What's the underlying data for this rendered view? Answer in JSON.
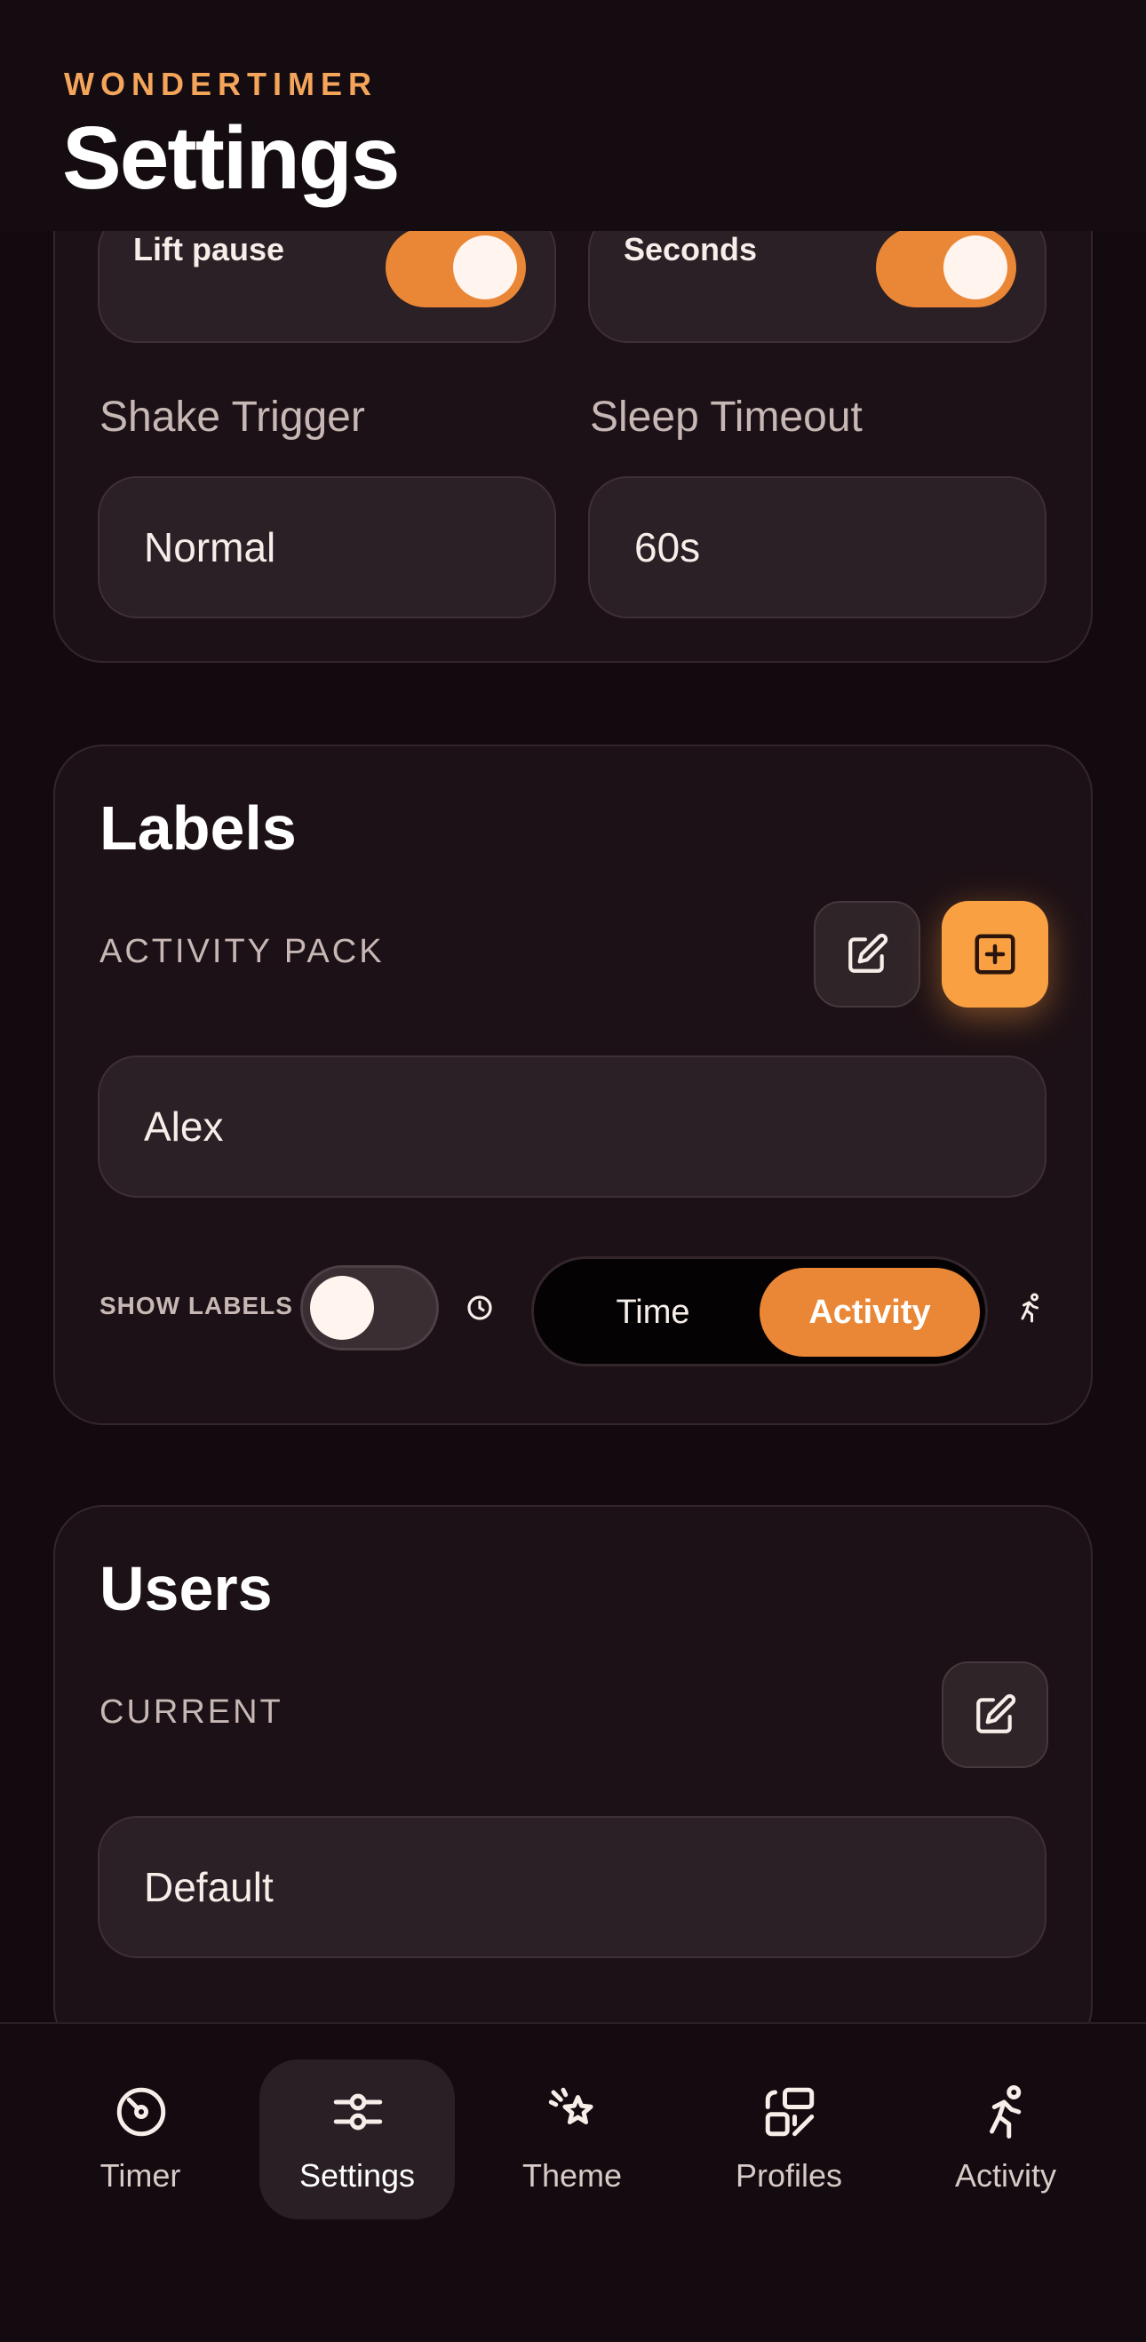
{
  "header": {
    "brand": "WONDERTIMER",
    "title": "Settings"
  },
  "display_card": {
    "lift_pause": {
      "label": "Lift pause",
      "on": true
    },
    "seconds": {
      "label": "Seconds",
      "on": true
    },
    "shake_trigger": {
      "label": "Shake Trigger",
      "value": "Normal"
    },
    "sleep_timeout": {
      "label": "Sleep Timeout",
      "value": "60s"
    }
  },
  "labels_card": {
    "title": "Labels",
    "section": "ACTIVITY PACK",
    "pack_value": "Alex",
    "show_labels": {
      "label": "SHOW LABELS",
      "on": false
    },
    "mode": {
      "options": [
        "Time",
        "Activity"
      ],
      "selected": "Activity"
    }
  },
  "users_card": {
    "title": "Users",
    "section": "CURRENT",
    "current_value": "Default"
  },
  "nav": {
    "items": [
      {
        "label": "Timer",
        "icon": "timer-icon"
      },
      {
        "label": "Settings",
        "icon": "sliders-icon",
        "active": true
      },
      {
        "label": "Theme",
        "icon": "theme-sparkle-icon"
      },
      {
        "label": "Profiles",
        "icon": "profiles-icon"
      },
      {
        "label": "Activity",
        "icon": "running-icon"
      }
    ]
  },
  "colors": {
    "accent": "#ea8736",
    "brand": "#f4a55a",
    "background": "#120a0f",
    "card": "#1c1116"
  }
}
